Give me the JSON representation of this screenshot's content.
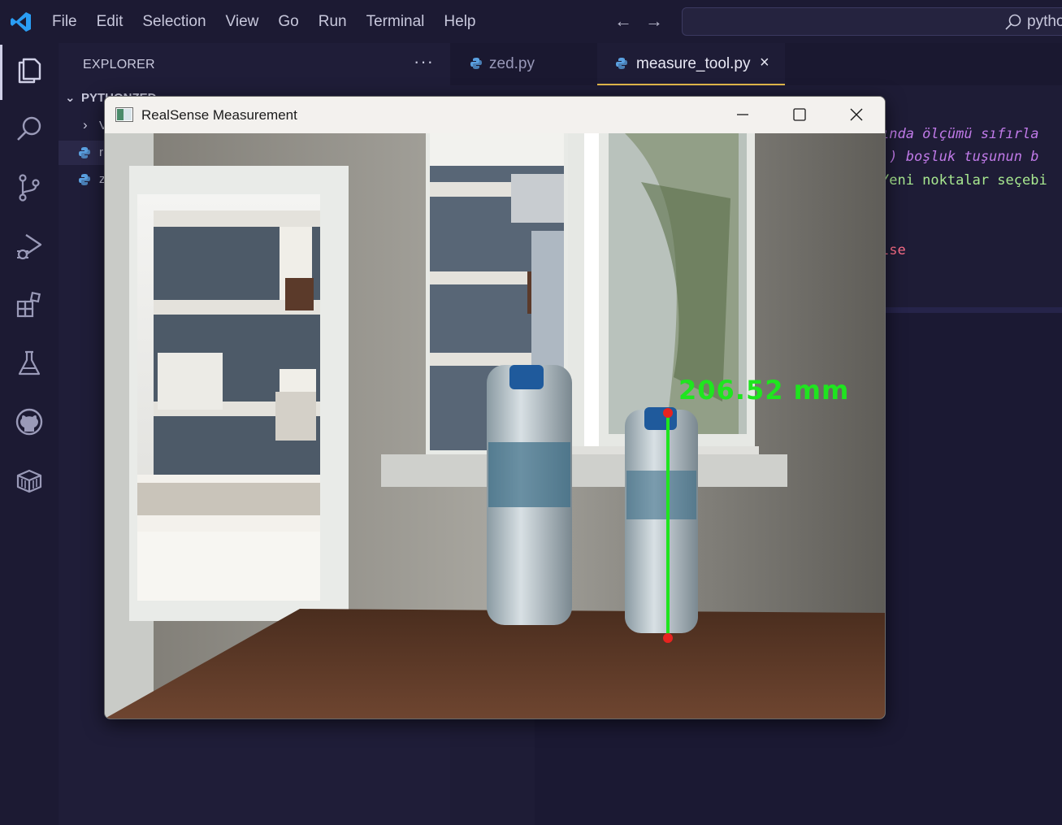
{
  "menu": {
    "items": [
      "File",
      "Edit",
      "Selection",
      "View",
      "Go",
      "Run",
      "Terminal",
      "Help"
    ]
  },
  "command_center": {
    "text": "pytho"
  },
  "activity_bar": {
    "icons": [
      "explorer-icon",
      "search-icon",
      "source-control-icon",
      "run-debug-icon",
      "extensions-icon",
      "testing-icon",
      "github-icon",
      "remote-explorer-icon"
    ]
  },
  "sidebar": {
    "title": "EXPLORER",
    "more": "···",
    "section": "PYTHONZED",
    "rows": [
      {
        "chevron": "›",
        "label": "V"
      },
      {
        "label": "r"
      },
      {
        "label": "z"
      }
    ]
  },
  "editor": {
    "tabs": [
      {
        "label": "zed.py",
        "active": false
      },
      {
        "label": "measure_tool.py",
        "active": true,
        "close": "×"
      }
    ],
    "code_lines": [
      {
        "cls": "c-comment",
        "text": "ında ölçümü sıfırla"
      },
      {
        "cls": "c-comment",
        "text": "') boşluk tuşunun b"
      },
      {
        "cls": "c-string",
        "text": "Yeni noktalar seçebi"
      },
      {
        "cls": "c-kw",
        "text": "lse"
      }
    ]
  },
  "window": {
    "title": "RealSense Measurement",
    "measurement": "206.52  mm"
  },
  "colors": {
    "accent_tab": "#e0b84a",
    "measure_line": "#1fe51f",
    "measure_point": "#e8231f"
  }
}
